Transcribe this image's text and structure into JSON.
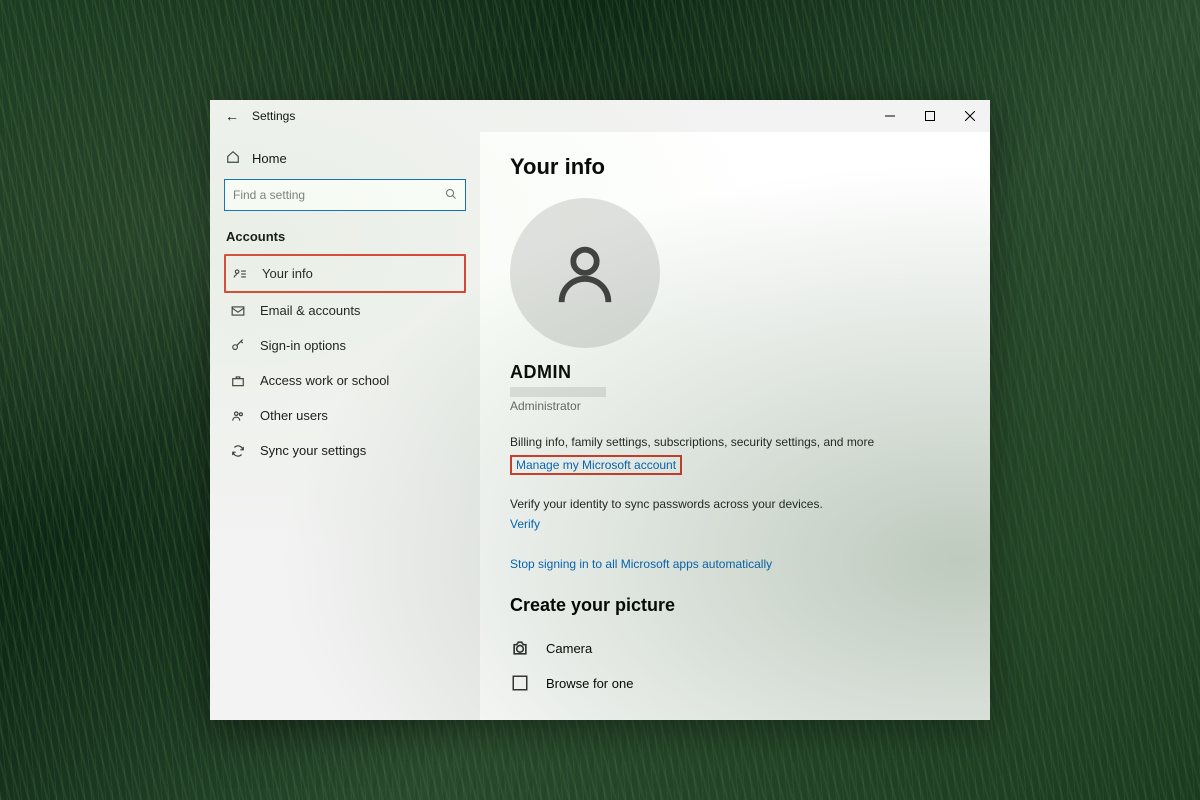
{
  "titlebar": {
    "title": "Settings"
  },
  "sidebar": {
    "home": "Home",
    "search_placeholder": "Find a setting",
    "category": "Accounts",
    "items": [
      {
        "label": "Your info"
      },
      {
        "label": "Email & accounts"
      },
      {
        "label": "Sign-in options"
      },
      {
        "label": "Access work or school"
      },
      {
        "label": "Other users"
      },
      {
        "label": "Sync your settings"
      }
    ]
  },
  "main": {
    "heading": "Your info",
    "username": "ADMIN",
    "role": "Administrator",
    "billing_text": "Billing info, family settings, subscriptions, security settings, and more",
    "manage_link": "Manage my Microsoft account",
    "verify_text": "Verify your identity to sync passwords across your devices.",
    "verify_link": "Verify",
    "stop_link": "Stop signing in to all Microsoft apps automatically",
    "picture_heading": "Create your picture",
    "camera_label": "Camera",
    "browse_label": "Browse for one"
  }
}
